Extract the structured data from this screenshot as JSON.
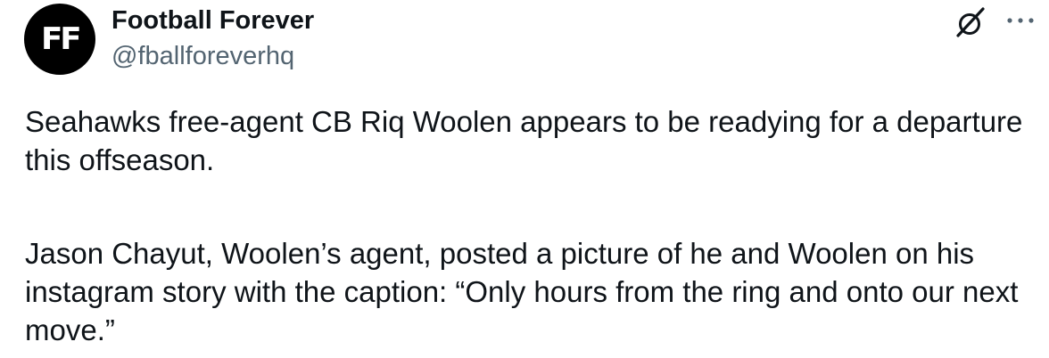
{
  "account": {
    "avatar_text": "FF",
    "display_name": "Football Forever",
    "handle": "@fballforeverhq"
  },
  "actions": {
    "grok_icon": "grok-slash-icon",
    "more_icon": "more-dots-icon"
  },
  "tweet": {
    "paragraph_1": "Seahawks free-agent CB Riq Woolen appears to be readying for a departure this offseason.",
    "paragraph_2": "Jason Chayut, Woolen’s agent, posted a picture of he and Woolen on his instagram story with the caption: “Only hours from the ring and onto our next move.”"
  },
  "colors": {
    "text_primary": "#0f1419",
    "text_secondary": "#536471",
    "avatar_bg": "#000000"
  }
}
